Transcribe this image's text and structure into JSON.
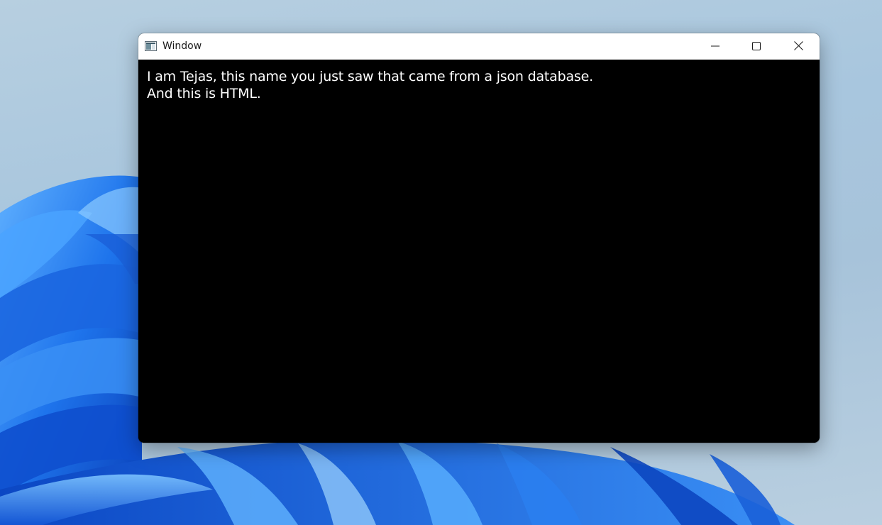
{
  "window": {
    "title": "Window",
    "icon": "app-window-icon",
    "controls": {
      "minimize_icon": "minimize-icon",
      "maximize_icon": "maximize-icon",
      "close_icon": "close-icon"
    }
  },
  "content": {
    "line1": "I am Tejas, this name you just saw that came from a json database.",
    "line2": "And this is HTML."
  },
  "colors": {
    "content_background": "#000000",
    "content_text": "#ffffff",
    "titlebar_background": "#ffffff",
    "wallpaper_accent": "#1a6fe8"
  }
}
